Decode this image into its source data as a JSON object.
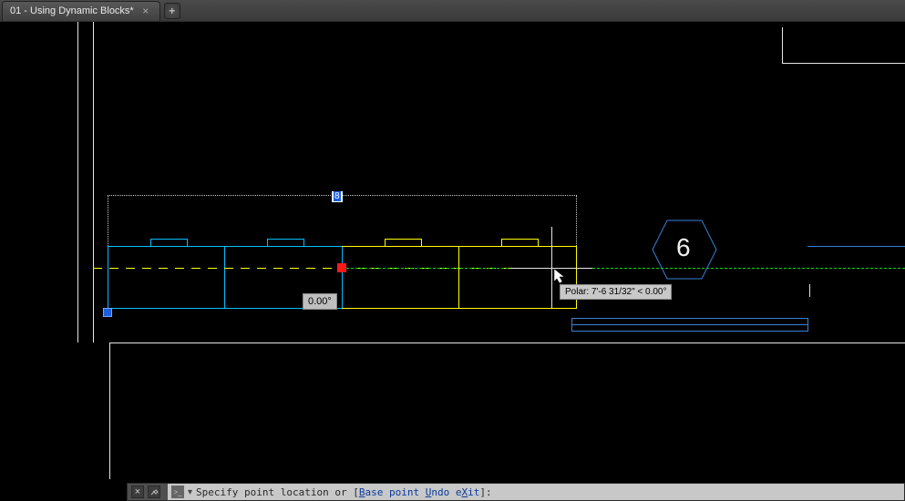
{
  "tab": {
    "title": "01 - Using Dynamic Blocks*",
    "close_icon": "close-icon",
    "new_tab_icon": "plus-icon"
  },
  "dynamic_input": {
    "value": "8",
    "angle": "0.00°"
  },
  "tooltip": {
    "text": "Polar: 7'-6 31/32\"  <  0.00°"
  },
  "detail_marker": {
    "number": "6"
  },
  "command": {
    "prompt_pre": "Specify point location or [",
    "option_base": "Base point",
    "option_undo": "Undo",
    "option_exit": "eXit",
    "prompt_post": "]:",
    "underline_b": "B",
    "underline_u": "U",
    "underline_x": "X"
  },
  "colors": {
    "cyan": "#00bfff",
    "lblue": "#3a7fd6",
    "yellow": "#ffff00",
    "green": "#00e000"
  }
}
